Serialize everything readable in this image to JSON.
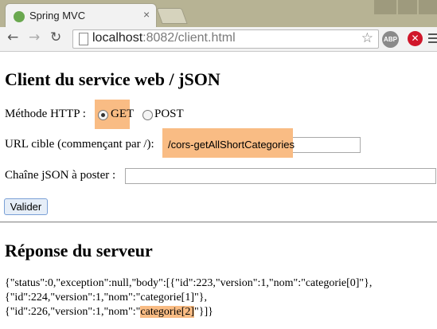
{
  "browser": {
    "tab_title": "Spring MVC",
    "tab_close": "×",
    "url_host": "localhost",
    "url_rest": ":8082/client.html",
    "abp_label": "ABP"
  },
  "page": {
    "title": "Client du service web / jSON",
    "method_label": "Méthode HTTP :",
    "method_options": [
      "GET",
      "POST"
    ],
    "method_selected": "GET",
    "url_label": "URL cible (commençant par /):",
    "url_value": "/cors-getAllShortCategories",
    "json_label": "Chaîne jSON à poster :",
    "json_value": "",
    "submit_label": "Valider",
    "response_title": "Réponse du serveur",
    "response_lines": [
      "{\"status\":0,\"exception\":null,\"body\":[{\"id\":223,\"version\":1,\"nom\":\"categorie[0]\"},",
      "{\"id\":224,\"version\":1,\"nom\":\"categorie[1]\"},",
      "{\"id\":226,\"version\":1,\"nom\":\""
    ],
    "response_highlight": "categorie[2]",
    "response_tail": "\"}]}"
  },
  "colors": {
    "highlight": "#f9bc84",
    "tabstrip": "#b7b394"
  },
  "icons": [
    "back-icon",
    "forward-icon",
    "reload-icon",
    "page-icon",
    "star-icon",
    "adblock-icon",
    "stop-icon",
    "menu-icon"
  ]
}
